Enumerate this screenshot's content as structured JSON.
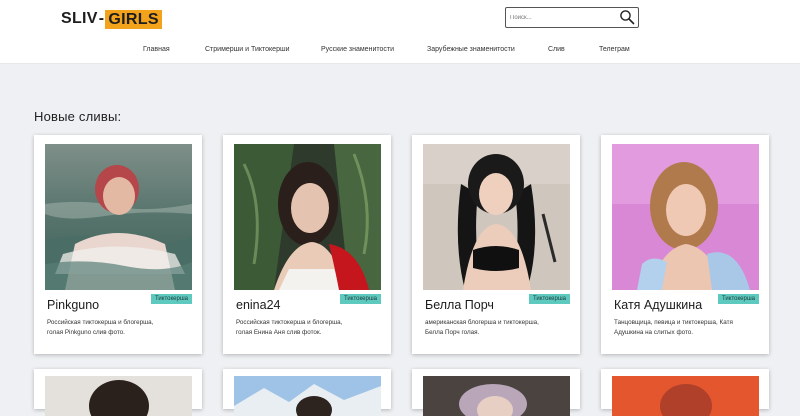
{
  "header": {
    "logo_left": "SLIV",
    "logo_sep": "-",
    "logo_right": "GIRLS",
    "search_placeholder": "Поиск...",
    "search_icon": "search-icon"
  },
  "nav": {
    "items": [
      {
        "label": "Главная"
      },
      {
        "label": "Стримерши и Тиктокерши"
      },
      {
        "label": "Русские знаменитости"
      },
      {
        "label": "Зарубежные знаменитости"
      },
      {
        "label": "Слив"
      },
      {
        "label": "Телеграм"
      }
    ]
  },
  "main": {
    "section_title": "Новые сливы:",
    "cards": [
      {
        "name": "Pinkguno",
        "badge": "Тиктокерша",
        "description": "Российская тиктокерша и блогерша, голая Pinkguno слив фото."
      },
      {
        "name": "enina24",
        "badge": "Тиктокерша",
        "description": "Российская тиктокерша и блогерша, голая Енина Аня слив фоток."
      },
      {
        "name": "Белла Порч",
        "badge": "Тиктокерша",
        "description": "американская блогерша и тиктокерша, Белла Порч голая."
      },
      {
        "name": "Катя Адушкина",
        "badge": "Тиктокерша",
        "description": "Танцовщица, певица и тиктокерша, Катя Адушкина на слитых фото."
      }
    ]
  },
  "colors": {
    "accent": "#f2a31b",
    "badge": "#5ec9bf",
    "background": "#eef0f3"
  }
}
